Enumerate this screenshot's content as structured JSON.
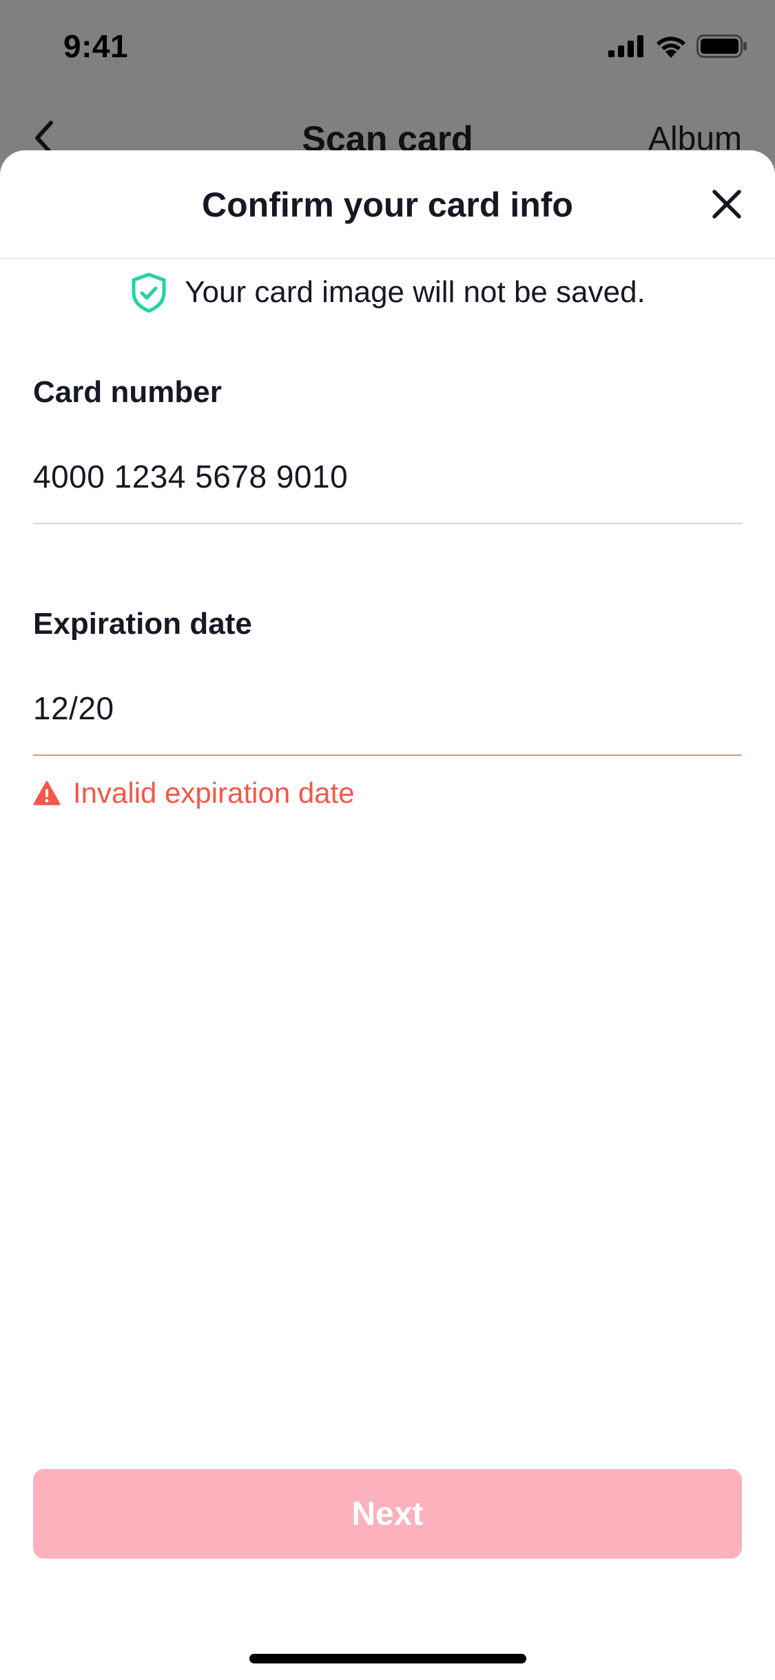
{
  "status_bar": {
    "time": "9:41",
    "icons": [
      "cellular-signal-icon",
      "wifi-icon",
      "battery-icon"
    ]
  },
  "nav": {
    "back_icon": "chevron-left-icon",
    "title": "Scan card",
    "album_label": "Album"
  },
  "sheet": {
    "title": "Confirm your card info",
    "close_icon": "close-icon",
    "privacy_icon": "shield-check-icon",
    "privacy_text": "Your card image will not be saved.",
    "card_number": {
      "label": "Card number",
      "value": "4000 1234 5678 9010"
    },
    "expiration": {
      "label": "Expiration date",
      "value": "12/20",
      "error_icon": "warning-icon",
      "error_text": "Invalid expiration date"
    },
    "next_label": "Next"
  },
  "colors": {
    "accent_teal": "#22d3a3",
    "error_red": "#f1584b",
    "button_disabled_pink": "#fdb1bd",
    "overlay_gray": "#808080"
  }
}
